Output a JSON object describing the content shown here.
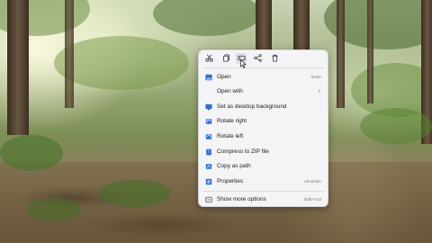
{
  "colors": {
    "menu_bg": "#f4f4f6",
    "icon_blue": "#2f6fd6",
    "text": "#1b1b1b",
    "shortcut_text": "#777777"
  },
  "quick_actions": [
    {
      "name": "cut",
      "icon": "scissors-icon"
    },
    {
      "name": "copy",
      "icon": "copy-icon"
    },
    {
      "name": "rename",
      "icon": "rename-icon"
    },
    {
      "name": "share",
      "icon": "share-icon"
    },
    {
      "name": "delete",
      "icon": "trash-icon"
    }
  ],
  "menu": {
    "items": [
      {
        "label": "Open",
        "shortcut": "Enter",
        "icon": "image-file-icon"
      },
      {
        "label": "Open with",
        "shortcut": "",
        "icon": "open-with-icon"
      },
      {
        "label": "Set as desktop background",
        "shortcut": "",
        "icon": "desktop-background-icon"
      },
      {
        "label": "Rotate right",
        "shortcut": "",
        "icon": "rotate-right-icon"
      },
      {
        "label": "Rotate left",
        "shortcut": "",
        "icon": "rotate-left-icon"
      },
      {
        "label": "Compress to ZIP file",
        "shortcut": "",
        "icon": "zip-icon"
      },
      {
        "label": "Copy as path",
        "shortcut": "",
        "icon": "copy-path-icon"
      },
      {
        "label": "Properties",
        "shortcut": "Alt+Enter",
        "icon": "properties-icon"
      },
      {
        "label": "Show more options",
        "shortcut": "Shift+F10",
        "icon": "more-options-icon"
      }
    ]
  }
}
